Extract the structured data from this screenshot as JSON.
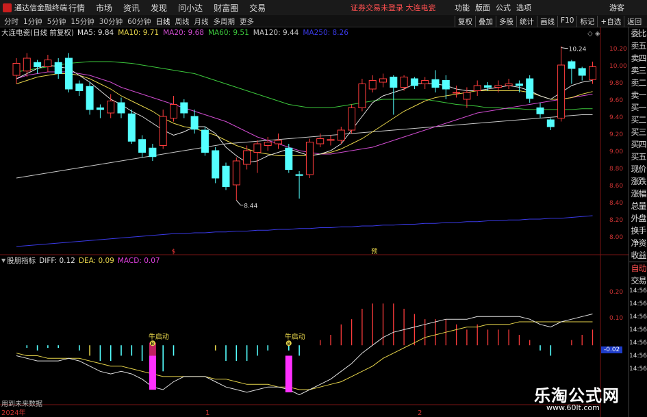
{
  "app": {
    "title": "通达信金融终端",
    "notice": "证券交易未登录  大连电瓷",
    "guest": "游客"
  },
  "main_menu": [
    "行情",
    "市场",
    "资讯",
    "发现",
    "问小达",
    "财富圈",
    "交易"
  ],
  "right_menu": [
    "功能",
    "版面",
    "公式",
    "选项"
  ],
  "periods": {
    "items": [
      "分时",
      "1分钟",
      "5分钟",
      "15分钟",
      "30分钟",
      "60分钟",
      "日线",
      "周线",
      "月线",
      "多周期",
      "更多"
    ],
    "selected_index": 6
  },
  "toolbar_buttons": [
    "复权",
    "叠加",
    "多股",
    "统计",
    "画线",
    "F10",
    "标记",
    "+自选",
    "返回"
  ],
  "stock": {
    "title": "大连电瓷(日线 前复权)"
  },
  "ma_legend": [
    {
      "label": "MA5: 9.84",
      "color": "#e0e0e0"
    },
    {
      "label": "MA10: 9.71",
      "color": "#e6d44a"
    },
    {
      "label": "MA20: 9.68",
      "color": "#d04cd0"
    },
    {
      "label": "MA60: 9.51",
      "color": "#3cc83c"
    },
    {
      "label": "MA120: 9.44",
      "color": "#c8c8c8"
    },
    {
      "label": "MA250: 8.26",
      "color": "#3a3ae8"
    }
  ],
  "indicator": {
    "name": "股朋指标",
    "diff": "DIFF: 0.12",
    "dea": "DEA: 0.09",
    "macd": "MACD: 0.07",
    "diff_color": "#e0e0e0",
    "dea_color": "#e6d44a",
    "macd_color": "#e040e0"
  },
  "signal_label": "牛启动",
  "signal_badge": "B",
  "price_axis": [
    "10.20",
    "10.00",
    "9.80",
    "9.60",
    "9.40",
    "9.20",
    "9.00",
    "8.80",
    "8.60",
    "8.40",
    "8.20",
    "8.00"
  ],
  "macd_axis": [
    "0.20",
    "0.10",
    "-0.02"
  ],
  "macd_axis_current": "-0.02",
  "time_axis": [
    "14:56",
    "14:56",
    "14:56",
    "14:56",
    "14:56",
    "14:56",
    "14:56"
  ],
  "x_axis_labels": [
    "2024年",
    "1",
    "2"
  ],
  "side_panel": [
    "委比",
    "卖五",
    "卖四",
    "卖三",
    "卖二",
    "卖一",
    "买一",
    "买二",
    "买三",
    "买四",
    "买五",
    "现价",
    "涨跌",
    "涨幅",
    "总量",
    "外盘",
    "换手",
    "净资",
    "收益",
    "自动",
    "交易"
  ],
  "annotations": {
    "high": "10.24",
    "low": "8.44",
    "marker1": "$",
    "marker2": "预"
  },
  "footnote": "用到未来数据",
  "watermark": {
    "cn": "乐淘公式网",
    "url": "www.60lt.com"
  },
  "chart_data": [
    {
      "type": "candlestick",
      "title": "大连电瓷(日线 前复权)",
      "ylim": [
        7.9,
        10.3
      ],
      "candles": [
        {
          "o": 9.9,
          "c": 10.04,
          "h": 10.1,
          "l": 9.8
        },
        {
          "o": 9.95,
          "c": 10.1,
          "h": 10.16,
          "l": 9.88
        },
        {
          "o": 10.05,
          "c": 10.0,
          "h": 10.08,
          "l": 9.92
        },
        {
          "o": 10.0,
          "c": 10.08,
          "h": 10.14,
          "l": 9.94
        },
        {
          "o": 10.05,
          "c": 9.92,
          "h": 10.1,
          "l": 9.86
        },
        {
          "o": 10.1,
          "c": 9.74,
          "h": 10.16,
          "l": 9.7
        },
        {
          "o": 9.8,
          "c": 9.72,
          "h": 9.84,
          "l": 9.66
        },
        {
          "o": 9.77,
          "c": 9.5,
          "h": 9.82,
          "l": 9.44
        },
        {
          "o": 9.52,
          "c": 9.5,
          "h": 9.56,
          "l": 9.4
        },
        {
          "o": 9.46,
          "c": 9.6,
          "h": 9.68,
          "l": 9.4
        },
        {
          "o": 9.58,
          "c": 9.46,
          "h": 9.64,
          "l": 9.4
        },
        {
          "o": 9.45,
          "c": 9.13,
          "h": 9.5,
          "l": 9.1
        },
        {
          "o": 9.15,
          "c": 9.0,
          "h": 9.2,
          "l": 8.94
        },
        {
          "o": 9.05,
          "c": 8.95,
          "h": 9.1,
          "l": 8.9
        },
        {
          "o": 9.08,
          "c": 9.42,
          "h": 9.5,
          "l": 9.04
        },
        {
          "o": 9.4,
          "c": 9.56,
          "h": 9.66,
          "l": 9.36
        },
        {
          "o": 9.58,
          "c": 9.46,
          "h": 9.62,
          "l": 9.4
        },
        {
          "o": 9.42,
          "c": 9.27,
          "h": 9.5,
          "l": 9.22
        },
        {
          "o": 9.26,
          "c": 9.0,
          "h": 9.3,
          "l": 8.96
        },
        {
          "o": 9.02,
          "c": 8.7,
          "h": 9.06,
          "l": 8.64
        },
        {
          "o": 8.84,
          "c": 8.6,
          "h": 8.88,
          "l": 8.56
        },
        {
          "o": 8.62,
          "c": 8.9,
          "h": 8.94,
          "l": 8.44
        },
        {
          "o": 8.86,
          "c": 9.02,
          "h": 9.08,
          "l": 8.8
        },
        {
          "o": 9.0,
          "c": 9.1,
          "h": 9.14,
          "l": 8.76
        },
        {
          "o": 9.08,
          "c": 9.12,
          "h": 9.18,
          "l": 9.02
        },
        {
          "o": 9.1,
          "c": 9.14,
          "h": 9.22,
          "l": 9.04
        },
        {
          "o": 9.05,
          "c": 8.8,
          "h": 9.1,
          "l": 8.76
        },
        {
          "o": 8.74,
          "c": 8.73,
          "h": 8.78,
          "l": 8.46
        },
        {
          "o": 8.74,
          "c": 9.12,
          "h": 9.16,
          "l": 8.7
        },
        {
          "o": 9.1,
          "c": 9.16,
          "h": 9.22,
          "l": 9.06
        },
        {
          "o": 9.14,
          "c": 9.15,
          "h": 9.2,
          "l": 9.08
        },
        {
          "o": 9.14,
          "c": 9.26,
          "h": 9.3,
          "l": 9.1
        },
        {
          "o": 9.26,
          "c": 9.52,
          "h": 9.56,
          "l": 9.22
        },
        {
          "o": 9.52,
          "c": 9.8,
          "h": 9.86,
          "l": 9.48
        },
        {
          "o": 9.74,
          "c": 9.84,
          "h": 9.9,
          "l": 9.7
        },
        {
          "o": 9.82,
          "c": 9.86,
          "h": 9.92,
          "l": 9.76
        },
        {
          "o": 9.88,
          "c": 9.76,
          "h": 9.9,
          "l": 9.44
        },
        {
          "o": 9.76,
          "c": 9.88,
          "h": 9.9,
          "l": 9.72
        },
        {
          "o": 9.86,
          "c": 9.78,
          "h": 9.88,
          "l": 9.74
        },
        {
          "o": 9.8,
          "c": 9.84,
          "h": 9.88,
          "l": 9.74
        },
        {
          "o": 9.85,
          "c": 9.76,
          "h": 9.96,
          "l": 9.7
        },
        {
          "o": 9.84,
          "c": 9.74,
          "h": 9.9,
          "l": 9.62
        },
        {
          "o": 9.7,
          "c": 9.7,
          "h": 9.78,
          "l": 9.64
        },
        {
          "o": 9.62,
          "c": 9.7,
          "h": 9.76,
          "l": 9.52
        },
        {
          "o": 9.72,
          "c": 9.78,
          "h": 9.84,
          "l": 9.66
        },
        {
          "o": 9.78,
          "c": 9.76,
          "h": 9.82,
          "l": 9.72
        },
        {
          "o": 9.76,
          "c": 9.78,
          "h": 9.84,
          "l": 9.7
        },
        {
          "o": 9.78,
          "c": 9.8,
          "h": 9.86,
          "l": 9.74
        },
        {
          "o": 9.8,
          "c": 9.78,
          "h": 9.84,
          "l": 9.7
        },
        {
          "o": 9.86,
          "c": 9.63,
          "h": 9.9,
          "l": 9.58
        },
        {
          "o": 9.52,
          "c": 9.45,
          "h": 9.58,
          "l": 9.4
        },
        {
          "o": 9.38,
          "c": 9.3,
          "h": 9.4,
          "l": 9.26
        },
        {
          "o": 9.4,
          "c": 10.02,
          "h": 10.24,
          "l": 9.36
        },
        {
          "o": 10.06,
          "c": 9.98,
          "h": 10.08,
          "l": 9.8
        },
        {
          "o": 9.98,
          "c": 9.9,
          "h": 10.0,
          "l": 9.84
        },
        {
          "o": 9.85,
          "c": 10.0,
          "h": 10.06,
          "l": 9.8
        }
      ],
      "ma5": [
        9.86,
        9.92,
        9.98,
        10.02,
        10.0,
        9.98,
        9.9,
        9.82,
        9.72,
        9.62,
        9.56,
        9.48,
        9.42,
        9.34,
        9.26,
        9.2,
        9.24,
        9.3,
        9.3,
        9.22,
        9.06,
        8.96,
        8.88,
        8.9,
        8.96,
        9.0,
        9.04,
        9.0,
        8.96,
        8.98,
        9.02,
        9.1,
        9.26,
        9.42,
        9.58,
        9.66,
        9.7,
        9.74,
        9.8,
        9.8,
        9.8,
        9.78,
        9.74,
        9.72,
        9.72,
        9.74,
        9.76,
        9.78,
        9.76,
        9.72,
        9.66,
        9.62,
        9.7,
        9.78,
        9.82,
        9.84
      ],
      "ma10": [
        9.8,
        9.84,
        9.88,
        9.9,
        9.92,
        9.92,
        9.9,
        9.86,
        9.8,
        9.74,
        9.66,
        9.6,
        9.54,
        9.48,
        9.4,
        9.34,
        9.3,
        9.28,
        9.24,
        9.2,
        9.14,
        9.08,
        9.04,
        9.0,
        8.98,
        8.96,
        8.96,
        8.96,
        8.96,
        8.98,
        9.0,
        9.04,
        9.1,
        9.16,
        9.24,
        9.32,
        9.4,
        9.48,
        9.54,
        9.6,
        9.64,
        9.66,
        9.68,
        9.7,
        9.72,
        9.72,
        9.72,
        9.72,
        9.72,
        9.7,
        9.66,
        9.62,
        9.62,
        9.64,
        9.68,
        9.71
      ],
      "ma20": [
        9.86,
        9.9,
        9.92,
        9.94,
        9.94,
        9.94,
        9.92,
        9.9,
        9.86,
        9.82,
        9.76,
        9.72,
        9.68,
        9.64,
        9.6,
        9.56,
        9.52,
        9.48,
        9.44,
        9.4,
        9.36,
        9.3,
        9.24,
        9.18,
        9.14,
        9.1,
        9.06,
        9.02,
        9.0,
        8.98,
        8.98,
        9.0,
        9.02,
        9.04,
        9.06,
        9.1,
        9.14,
        9.18,
        9.22,
        9.26,
        9.3,
        9.34,
        9.38,
        9.42,
        9.46,
        9.48,
        9.5,
        9.52,
        9.54,
        9.56,
        9.58,
        9.6,
        9.62,
        9.64,
        9.66,
        9.68
      ],
      "ma60": [
        9.94,
        9.96,
        9.98,
        10.0,
        10.02,
        10.04,
        10.05,
        10.06,
        10.06,
        10.06,
        10.05,
        10.04,
        10.02,
        10.0,
        9.98,
        9.96,
        9.94,
        9.92,
        9.88,
        9.84,
        9.8,
        9.76,
        9.72,
        9.68,
        9.64,
        9.6,
        9.56,
        9.54,
        9.52,
        9.52,
        9.52,
        9.54,
        9.56,
        9.58,
        9.6,
        9.62,
        9.62,
        9.62,
        9.62,
        9.62,
        9.6,
        9.58,
        9.56,
        9.55,
        9.54,
        9.52,
        9.52,
        9.51,
        9.51,
        9.5,
        9.5,
        9.5,
        9.5,
        9.5,
        9.51,
        9.51
      ],
      "ma120": [
        8.7,
        8.72,
        8.74,
        8.76,
        8.78,
        8.8,
        8.82,
        8.84,
        8.86,
        8.88,
        8.9,
        8.92,
        8.94,
        8.96,
        8.98,
        9.0,
        9.02,
        9.04,
        9.06,
        9.08,
        9.1,
        9.11,
        9.12,
        9.13,
        9.14,
        9.15,
        9.16,
        9.17,
        9.18,
        9.19,
        9.2,
        9.21,
        9.22,
        9.23,
        9.24,
        9.25,
        9.26,
        9.27,
        9.28,
        9.29,
        9.3,
        9.31,
        9.32,
        9.33,
        9.34,
        9.35,
        9.36,
        9.37,
        9.38,
        9.39,
        9.4,
        9.41,
        9.42,
        9.43,
        9.44,
        9.44
      ],
      "ma250": [
        7.9,
        7.91,
        7.92,
        7.93,
        7.94,
        7.95,
        7.96,
        7.97,
        7.98,
        7.99,
        8.0,
        8.01,
        8.02,
        8.03,
        8.04,
        8.05,
        8.05,
        8.06,
        8.06,
        8.07,
        8.07,
        8.08,
        8.08,
        8.09,
        8.09,
        8.1,
        8.1,
        8.11,
        8.11,
        8.12,
        8.12,
        8.13,
        8.13,
        8.14,
        8.14,
        8.15,
        8.15,
        8.16,
        8.16,
        8.17,
        8.17,
        8.18,
        8.18,
        8.19,
        8.19,
        8.2,
        8.2,
        8.21,
        8.21,
        8.22,
        8.22,
        8.23,
        8.23,
        8.24,
        8.25,
        8.26
      ]
    },
    {
      "type": "macd",
      "title": "股朋指标",
      "ylim": [
        -0.22,
        0.3
      ],
      "diff": [
        -0.04,
        -0.05,
        -0.06,
        -0.06,
        -0.06,
        -0.05,
        -0.06,
        -0.08,
        -0.1,
        -0.11,
        -0.1,
        -0.11,
        -0.13,
        -0.16,
        -0.17,
        -0.14,
        -0.12,
        -0.12,
        -0.12,
        -0.14,
        -0.16,
        -0.17,
        -0.18,
        -0.17,
        -0.16,
        -0.16,
        -0.17,
        -0.19,
        -0.17,
        -0.15,
        -0.13,
        -0.1,
        -0.07,
        -0.03,
        0.0,
        0.03,
        0.05,
        0.06,
        0.07,
        0.08,
        0.09,
        0.1,
        0.1,
        0.1,
        0.11,
        0.11,
        0.11,
        0.11,
        0.11,
        0.1,
        0.08,
        0.07,
        0.09,
        0.1,
        0.11,
        0.12
      ],
      "dea": [
        -0.03,
        -0.04,
        -0.04,
        -0.05,
        -0.05,
        -0.05,
        -0.05,
        -0.06,
        -0.07,
        -0.08,
        -0.08,
        -0.09,
        -0.1,
        -0.11,
        -0.12,
        -0.12,
        -0.12,
        -0.12,
        -0.12,
        -0.13,
        -0.13,
        -0.14,
        -0.15,
        -0.15,
        -0.15,
        -0.16,
        -0.16,
        -0.17,
        -0.17,
        -0.16,
        -0.15,
        -0.14,
        -0.12,
        -0.1,
        -0.08,
        -0.05,
        -0.03,
        -0.01,
        0.01,
        0.03,
        0.04,
        0.05,
        0.06,
        0.07,
        0.07,
        0.08,
        0.08,
        0.08,
        0.09,
        0.09,
        0.09,
        0.09,
        0.09,
        0.09,
        0.09,
        0.09
      ],
      "macd": [
        0.0,
        -0.01,
        -0.02,
        -0.01,
        -0.01,
        0.0,
        -0.02,
        -0.04,
        -0.06,
        -0.06,
        -0.04,
        -0.04,
        -0.06,
        -0.1,
        -0.1,
        -0.04,
        0.0,
        0.0,
        0.0,
        -0.02,
        -0.06,
        -0.06,
        -0.06,
        -0.04,
        -0.02,
        0.0,
        -0.02,
        -0.04,
        0.0,
        0.02,
        0.04,
        0.08,
        0.1,
        0.14,
        0.16,
        0.16,
        0.16,
        0.14,
        0.12,
        0.1,
        0.1,
        0.1,
        0.08,
        0.06,
        0.08,
        0.06,
        0.06,
        0.06,
        0.04,
        0.02,
        -0.02,
        -0.04,
        0.0,
        0.02,
        0.04,
        0.06
      ],
      "signals": [
        13,
        26
      ]
    }
  ]
}
